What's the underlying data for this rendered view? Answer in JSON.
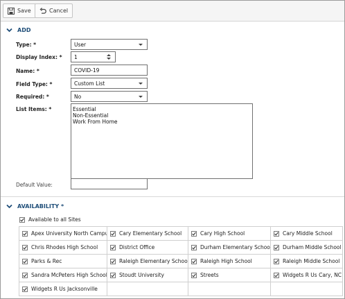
{
  "toolbar": {
    "save_label": "Save",
    "cancel_label": "Cancel"
  },
  "add_section": {
    "title": "ADD",
    "type": {
      "label": "Type: *",
      "value": "User"
    },
    "display_index": {
      "label": "Display Index: *",
      "value": "1"
    },
    "name": {
      "label": "Name: *",
      "value": "COVID-19"
    },
    "field_type": {
      "label": "Field Type: *",
      "value": "Custom List"
    },
    "required": {
      "label": "Required: *",
      "value": "No"
    },
    "list_items": {
      "label": "List Items: *",
      "lines": [
        "Essential",
        "Non-Essential",
        "Work From Home"
      ]
    },
    "default_value": {
      "label": "Default Value:",
      "value": ""
    }
  },
  "availability": {
    "title": "AVAILABILITY *",
    "all_sites_label": "Available to all Sites",
    "all_sites_checked": true,
    "sites": [
      [
        "Apex University North Campus",
        "Cary Elementary School",
        "Cary High School",
        "Cary Middle School"
      ],
      [
        "Chris Rhodes High School",
        "District Office",
        "Durham Elementary School",
        "Durham Middle School"
      ],
      [
        "Parks & Rec",
        "Raleigh Elementary School",
        "Raleigh High School",
        "Raleigh Middle School"
      ],
      [
        "Sandra McPeters High School",
        "Stoudt University",
        "Streets",
        "Widgets R Us Cary, NC"
      ],
      [
        "Widgets R Us Jacksonville"
      ]
    ]
  },
  "colors": {
    "accent": "#1f4e79",
    "toolbar_bg": "#f5f5f5",
    "border": "#707070"
  },
  "icons": {
    "save": "floppy-disk-icon",
    "cancel": "undo-arrow-icon",
    "collapse": "chevron-down-icon",
    "checkbox": "check-icon"
  }
}
